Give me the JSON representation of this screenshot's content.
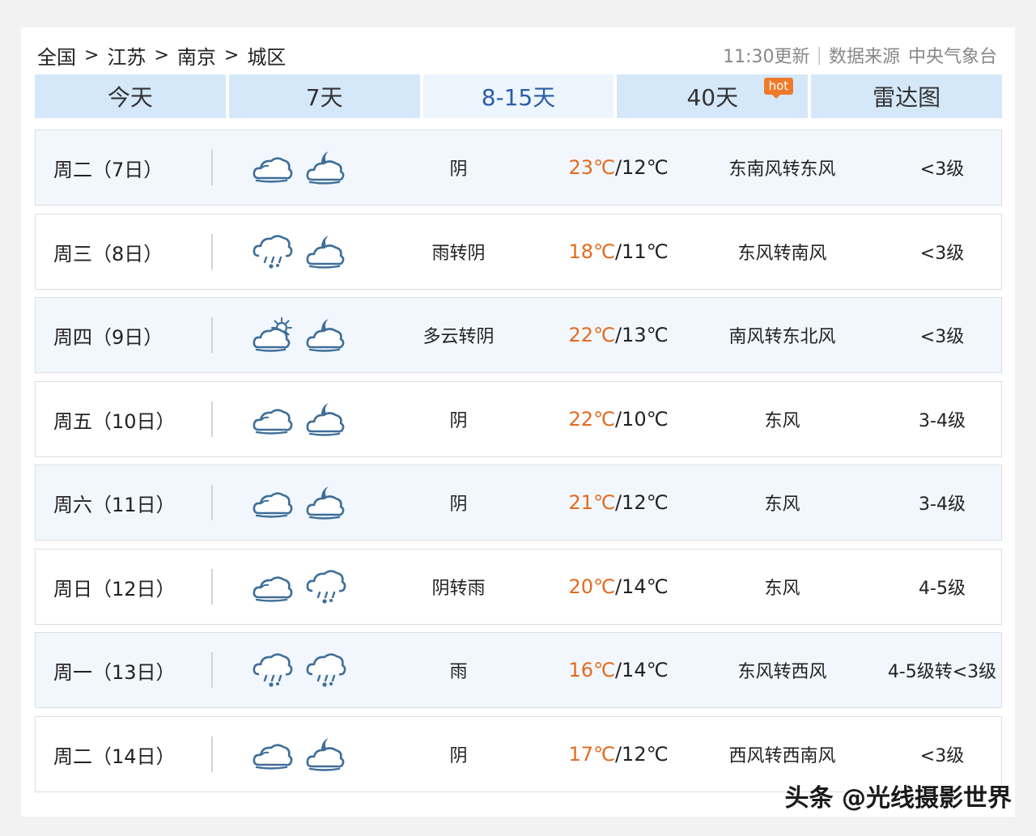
{
  "breadcrumb": [
    "全国",
    "江苏",
    "南京",
    "城区"
  ],
  "breadcrumb_sep": ">",
  "update_time": "11:30更新",
  "source_label": "数据来源",
  "source_name": "中央气象台",
  "tabs": [
    {
      "label": "今天"
    },
    {
      "label": "7天"
    },
    {
      "label": "8-15天",
      "active": true
    },
    {
      "label": "40天",
      "badge": "hot"
    },
    {
      "label": "雷达图"
    }
  ],
  "days": [
    {
      "day": "周二（7日）",
      "icon_day": "overcast-icon",
      "icon_night": "cloudy-night-icon",
      "condition": "阴",
      "high": "23℃",
      "low": "12℃",
      "wind": "东南风转东风",
      "level": "<3级"
    },
    {
      "day": "周三（8日）",
      "icon_day": "rain-icon",
      "icon_night": "cloudy-night-icon",
      "condition": "雨转阴",
      "high": "18℃",
      "low": "11℃",
      "wind": "东风转南风",
      "level": "<3级"
    },
    {
      "day": "周四（9日）",
      "icon_day": "partly-cloudy-icon",
      "icon_night": "cloudy-night-icon",
      "condition": "多云转阴",
      "high": "22℃",
      "low": "13℃",
      "wind": "南风转东北风",
      "level": "<3级"
    },
    {
      "day": "周五（10日）",
      "icon_day": "overcast-icon",
      "icon_night": "cloudy-night-icon",
      "condition": "阴",
      "high": "22℃",
      "low": "10℃",
      "wind": "东风",
      "level": "3-4级"
    },
    {
      "day": "周六（11日）",
      "icon_day": "overcast-icon",
      "icon_night": "cloudy-night-icon",
      "condition": "阴",
      "high": "21℃",
      "low": "12℃",
      "wind": "东风",
      "level": "3-4级"
    },
    {
      "day": "周日（12日）",
      "icon_day": "overcast-icon",
      "icon_night": "rain-icon",
      "condition": "阴转雨",
      "high": "20℃",
      "low": "14℃",
      "wind": "东风",
      "level": "4-5级"
    },
    {
      "day": "周一（13日）",
      "icon_day": "rain-icon",
      "icon_night": "rain-icon",
      "condition": "雨",
      "high": "16℃",
      "low": "14℃",
      "wind": "东风转西风",
      "level": "4-5级转<3级"
    },
    {
      "day": "周二（14日）",
      "icon_day": "overcast-icon",
      "icon_night": "cloudy-night-icon",
      "condition": "阴",
      "high": "17℃",
      "low": "12℃",
      "wind": "西风转西南风",
      "level": "<3级"
    }
  ],
  "colors": {
    "accent": "#2a5caa",
    "high_temp": "#e36a1e",
    "tab_bg": "#d5e8fa",
    "icon": "#3f6e98"
  },
  "watermark": "头条 @光线摄影世界"
}
